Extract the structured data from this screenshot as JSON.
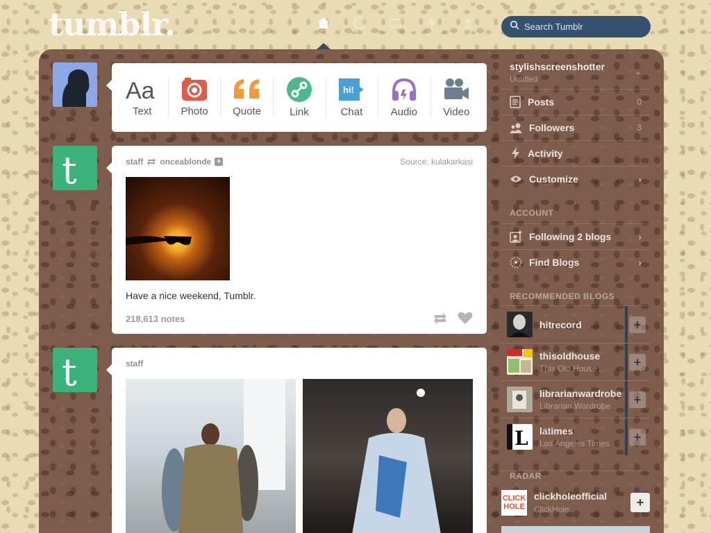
{
  "header": {
    "logo": "tumblr.",
    "search_placeholder": "Search Tumblr"
  },
  "composer": [
    {
      "label": "Text",
      "icon": "text-icon",
      "color": "#555555"
    },
    {
      "label": "Photo",
      "icon": "camera-icon",
      "color": "#e05c47"
    },
    {
      "label": "Quote",
      "icon": "quote-icon",
      "color": "#f09a3a"
    },
    {
      "label": "Link",
      "icon": "link-icon",
      "color": "#4bb88d"
    },
    {
      "label": "Chat",
      "icon": "chat-icon",
      "color": "#4aa0d5"
    },
    {
      "label": "Audio",
      "icon": "headphones-icon",
      "color": "#9a6fc9"
    },
    {
      "label": "Video",
      "icon": "video-camera-icon",
      "color": "#6f7f91"
    }
  ],
  "posts": [
    {
      "author": "staff",
      "reblogged_from": "onceablonde",
      "source_label": "Source:",
      "source_name": "kulakarkasi",
      "caption": "Have a nice weekend, Tumblr.",
      "notes": "218,613 notes"
    },
    {
      "author": "staff"
    }
  ],
  "sidebar": {
    "blog_name": "stylishscreenshotter",
    "blog_title": "Untitled",
    "items": [
      {
        "label": "Posts",
        "count": "0"
      },
      {
        "label": "Followers",
        "count": "3"
      },
      {
        "label": "Activity"
      },
      {
        "label": "Customize"
      }
    ],
    "account_heading": "ACCOUNT",
    "account_items": [
      {
        "label": "Following 2 blogs"
      },
      {
        "label": "Find Blogs"
      }
    ],
    "recommended_heading": "RECOMMENDED BLOGS",
    "recommended": [
      {
        "name": "hitrecord",
        "title": ""
      },
      {
        "name": "thisoldhouse",
        "title": "This Old House"
      },
      {
        "name": "librarianwardrobe",
        "title": "Librarian Wardrobe"
      },
      {
        "name": "latimes",
        "title": "Los Angeles Times"
      }
    ],
    "radar_heading": "RADAR",
    "radar": {
      "name": "clickholeofficial",
      "title": "ClickHole",
      "logo_top": "CLICK",
      "logo_bottom": "HOLE"
    }
  }
}
